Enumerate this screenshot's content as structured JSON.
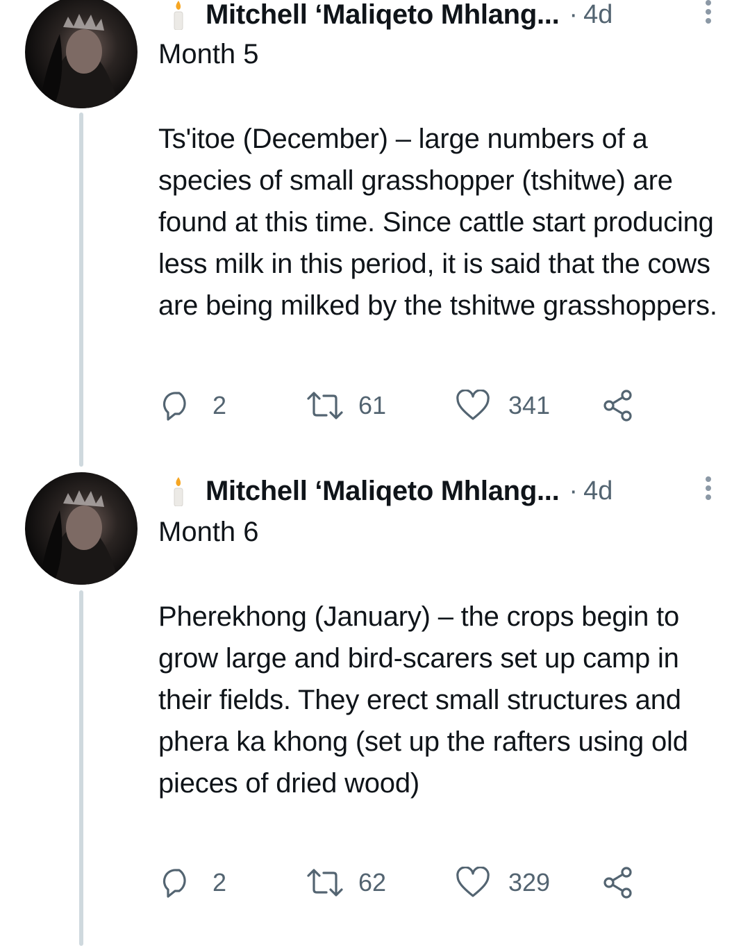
{
  "tweets": [
    {
      "author": "Mitchell ‘Maliqeto Mhlang...",
      "separator": "·",
      "time": "4d",
      "heading": "Month 5",
      "text": "Ts'itoe (December) – large numbers of a species of small grasshopper (tshitwe) are found at this time. Since cattle start producing less milk in this period, it is said that the cows are being milked by the tshitwe grasshoppers.",
      "replies": "2",
      "retweets": "61",
      "likes": "341"
    },
    {
      "author": "Mitchell ‘Maliqeto Mhlang...",
      "separator": "·",
      "time": "4d",
      "heading": "Month 6",
      "text": "Pherekhong (January) – the crops begin to grow large and bird-scarers set up camp in their fields. They erect small structures and phera ka khong (set up the rafters using old pieces of dried wood)",
      "replies": "2",
      "retweets": "62",
      "likes": "329"
    }
  ],
  "icons": {
    "author_emoji": "candle-icon",
    "reply": "reply-icon",
    "retweet": "retweet-icon",
    "like": "heart-icon",
    "share": "share-icon",
    "more": "more-options-icon"
  },
  "colors": {
    "text": "#0f1419",
    "secondary": "#536471",
    "thread_line": "#cfd9de"
  }
}
